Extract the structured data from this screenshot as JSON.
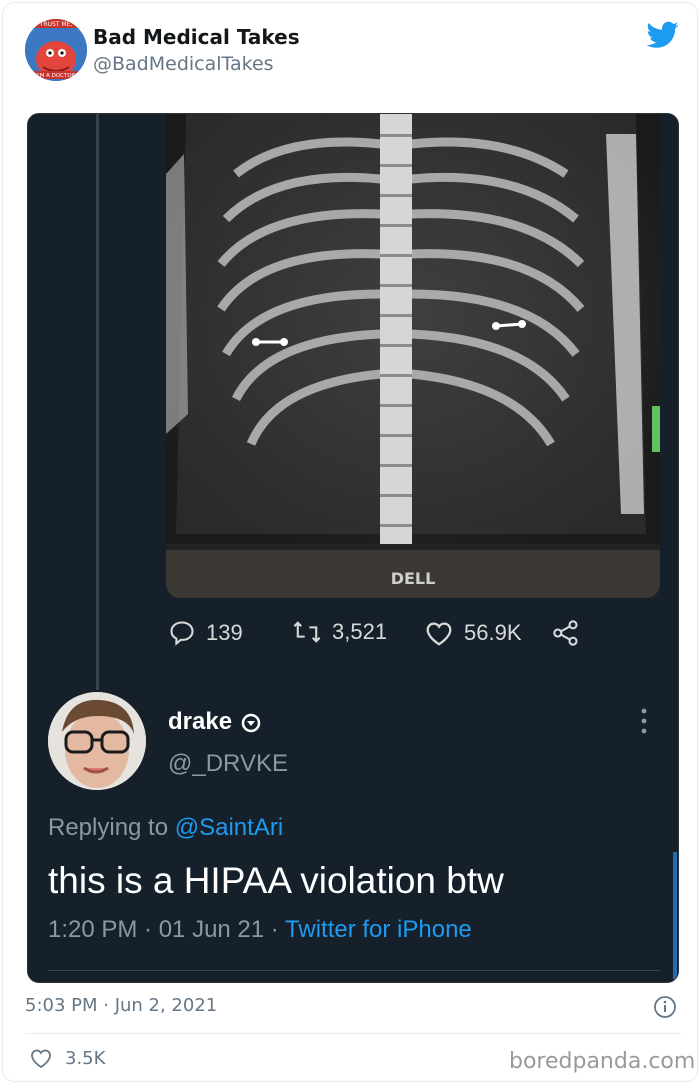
{
  "author": {
    "display_name": "Bad Medical Takes",
    "handle": "@BadMedicalTakes",
    "avatar_text_top": "TRUST ME,",
    "avatar_text_bottom": "I'M A DOCTOR"
  },
  "screenshot": {
    "monitor_brand": "DELL",
    "stats": {
      "replies": "139",
      "retweets": "3,521",
      "likes": "56.9K"
    },
    "reply": {
      "name": "drake",
      "handle": "@_DRVKE",
      "replying_prefix": "Replying to ",
      "replying_to": "@SaintAri",
      "text": "this is a HIPAA violation btw",
      "time": "1:20 PM · 01 Jun 21 · ",
      "source": "Twitter for iPhone"
    }
  },
  "timestamp": "5:03 PM · Jun 2, 2021",
  "like_count": "3.5K",
  "watermark": "boredpanda.com",
  "colors": {
    "twitter_blue": "#1d9bf0",
    "dark_bg": "#15202b"
  }
}
